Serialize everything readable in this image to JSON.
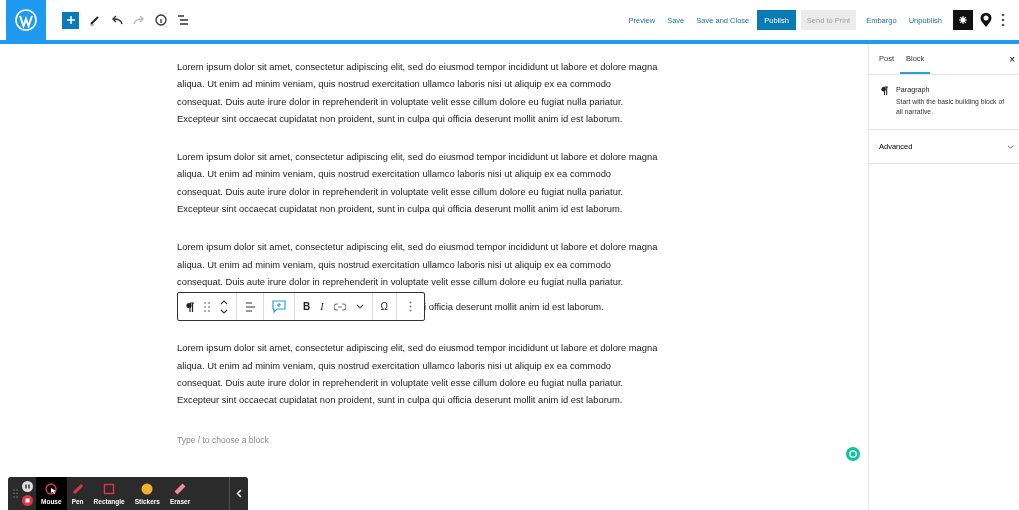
{
  "top_bar": {
    "actions": [
      {
        "label": "Preview",
        "kind": "link"
      },
      {
        "label": "Save",
        "kind": "link"
      },
      {
        "label": "Save and Close",
        "kind": "link"
      },
      {
        "label": "Publish",
        "kind": "primary"
      },
      {
        "label": "Send to Print",
        "kind": "disabled"
      },
      {
        "label": "Embargo",
        "kind": "link"
      },
      {
        "label": "Unpublish",
        "kind": "link"
      }
    ]
  },
  "paragraphs": [
    {
      "text": "Lorem ipsum dolor sit amet, consectetur adipiscing elit, sed do eiusmod tempor incididunt ut labore et dolore magna aliqua. Ut enim ad minim veniam, quis nostrud exercitation ullamco laboris nisi ut aliquip ex ea commodo consequat. Duis aute irure dolor in reprehenderit in voluptate velit esse cillum dolore eu fugiat nulla pariatur. Excepteur sint occaecat cupidatat non proident, sunt in culpa qui officia deserunt mollit anim id est laborum."
    },
    {
      "text": "Lorem ipsum dolor sit amet, consectetur adipiscing elit, sed do eiusmod tempor incididunt ut labore et dolore magna aliqua. Ut enim ad minim veniam, quis nostrud exercitation ullamco laboris nisi ut aliquip ex ea commodo consequat. Duis aute irure dolor in reprehenderit in voluptate velit esse cillum dolore eu fugiat nulla pariatur. Excepteur sint occaecat cupidatat non proident, sunt in culpa qui officia deserunt mollit anim id est laborum."
    },
    {
      "text": "Lorem ipsum dolor sit amet, consectetur adipiscing elit, sed do eiusmod tempor incididunt ut labore et dolore magna aliqua. Ut enim ad minim veniam, quis nostrud exercitation ullamco laboris nisi ut aliquip ex ea commodo consequat. Duis aute irure dolor in reprehenderit in voluptate velit esse cillum dolore eu fugiat nulla pariatur.",
      "text_after_toolbar": "i officia deserunt mollit anim id est laborum."
    },
    {
      "text": "Lorem ipsum dolor sit amet, consectetur adipiscing elit, sed do eiusmod tempor incididunt ut labore et dolore magna aliqua. Ut enim ad minim veniam, quis nostrud exercitation ullamco laboris nisi ut aliquip ex ea commodo consequat. Duis aute irure dolor in reprehenderit in voluptate velit esse cillum dolore eu fugiat nulla pariatur. Excepteur sint occaecat cupidatat non proident, sunt in culpa qui officia deserunt mollit anim id est laborum."
    }
  ],
  "block_toolbar": {
    "bold": "B",
    "italic": "I",
    "special_char": "Ω"
  },
  "new_block": {
    "placeholder": "Type / to choose a block"
  },
  "sidebar": {
    "tabs": [
      {
        "label": "Post",
        "selected": false
      },
      {
        "label": "Block",
        "selected": true
      }
    ],
    "close": "×",
    "block": {
      "title": "Paragraph",
      "description": "Start with the basic building block of all narrative."
    },
    "panels": [
      {
        "label": "Advanced",
        "expanded": false
      }
    ]
  },
  "recorder": {
    "tools": [
      {
        "label": "Mouse",
        "kind": "mouse",
        "selected": true
      },
      {
        "label": "Pen",
        "kind": "pen",
        "selected": false
      },
      {
        "label": "Rectangle",
        "kind": "rectangle",
        "selected": false
      },
      {
        "label": "Stickers",
        "kind": "stickers",
        "selected": false
      },
      {
        "label": "Eraser",
        "kind": "eraser",
        "selected": false
      }
    ]
  }
}
